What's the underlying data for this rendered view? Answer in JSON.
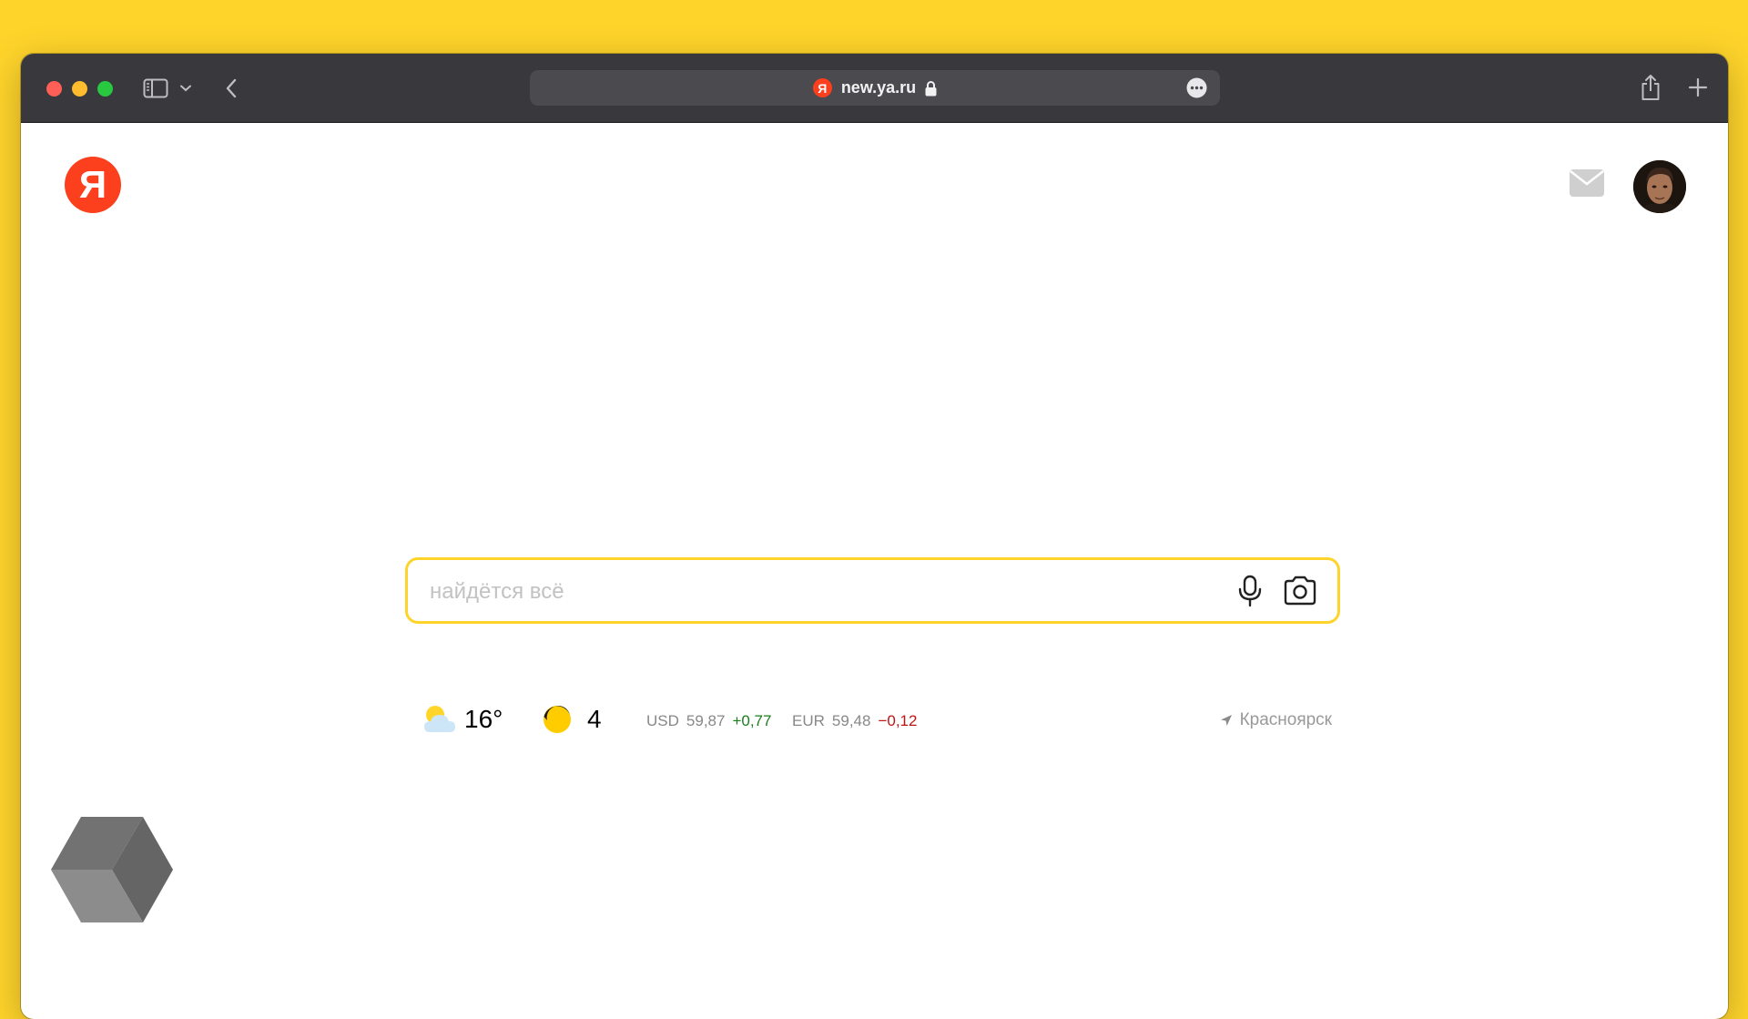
{
  "browser": {
    "url": "new.ya.ru",
    "colors": {
      "toolbar": "#38383d",
      "close": "#ff5f57",
      "minimize": "#febc2e",
      "zoom": "#28c840"
    }
  },
  "page": {
    "logo_text": "Я",
    "favicon_text": "Я",
    "search": {
      "placeholder": "найдётся всё",
      "value": ""
    },
    "weather": {
      "temperature": "16°",
      "icon": "partly-cloudy-icon"
    },
    "traffic": {
      "score": "4",
      "icon": "traffic-level-icon"
    },
    "currencies": [
      {
        "code": "USD",
        "value": "59,87",
        "change": "+0,77",
        "direction": "up"
      },
      {
        "code": "EUR",
        "value": "59,48",
        "change": "−0,12",
        "direction": "down"
      }
    ],
    "location": "Красноярск",
    "colors": {
      "accent": "#fed42b",
      "brand": "#fc3f1d",
      "positive": "#1a7f1a",
      "negative": "#c01414"
    }
  }
}
